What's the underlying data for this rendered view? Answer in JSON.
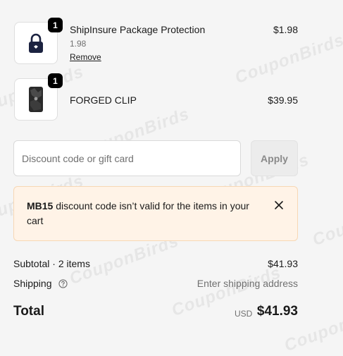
{
  "items": [
    {
      "quantity": "1",
      "name": "ShipInsure Package Protection",
      "subtitle": "1.98",
      "action": "Remove",
      "price": "$1.98",
      "icon": "lock-icon"
    },
    {
      "quantity": "1",
      "name": "FORGED CLIP",
      "price": "$39.95",
      "icon": "product-image"
    }
  ],
  "discount": {
    "placeholder": "Discount code or gift card",
    "apply_label": "Apply"
  },
  "alert": {
    "code": "MB15",
    "message": " discount code isn’t valid for the items in your cart",
    "icon": "close-icon"
  },
  "summary": {
    "subtotal_label": "Subtotal · 2 items",
    "subtotal_value": "$41.93",
    "shipping_label": "Shipping",
    "shipping_value": "Enter shipping address",
    "total_label": "Total",
    "currency": "USD",
    "total_value": "$41.93"
  },
  "watermark": "CouponBirds",
  "colors": {
    "alert_bg": "#fff3e7",
    "alert_border": "#f7d7b4",
    "badge_bg": "#000000"
  }
}
